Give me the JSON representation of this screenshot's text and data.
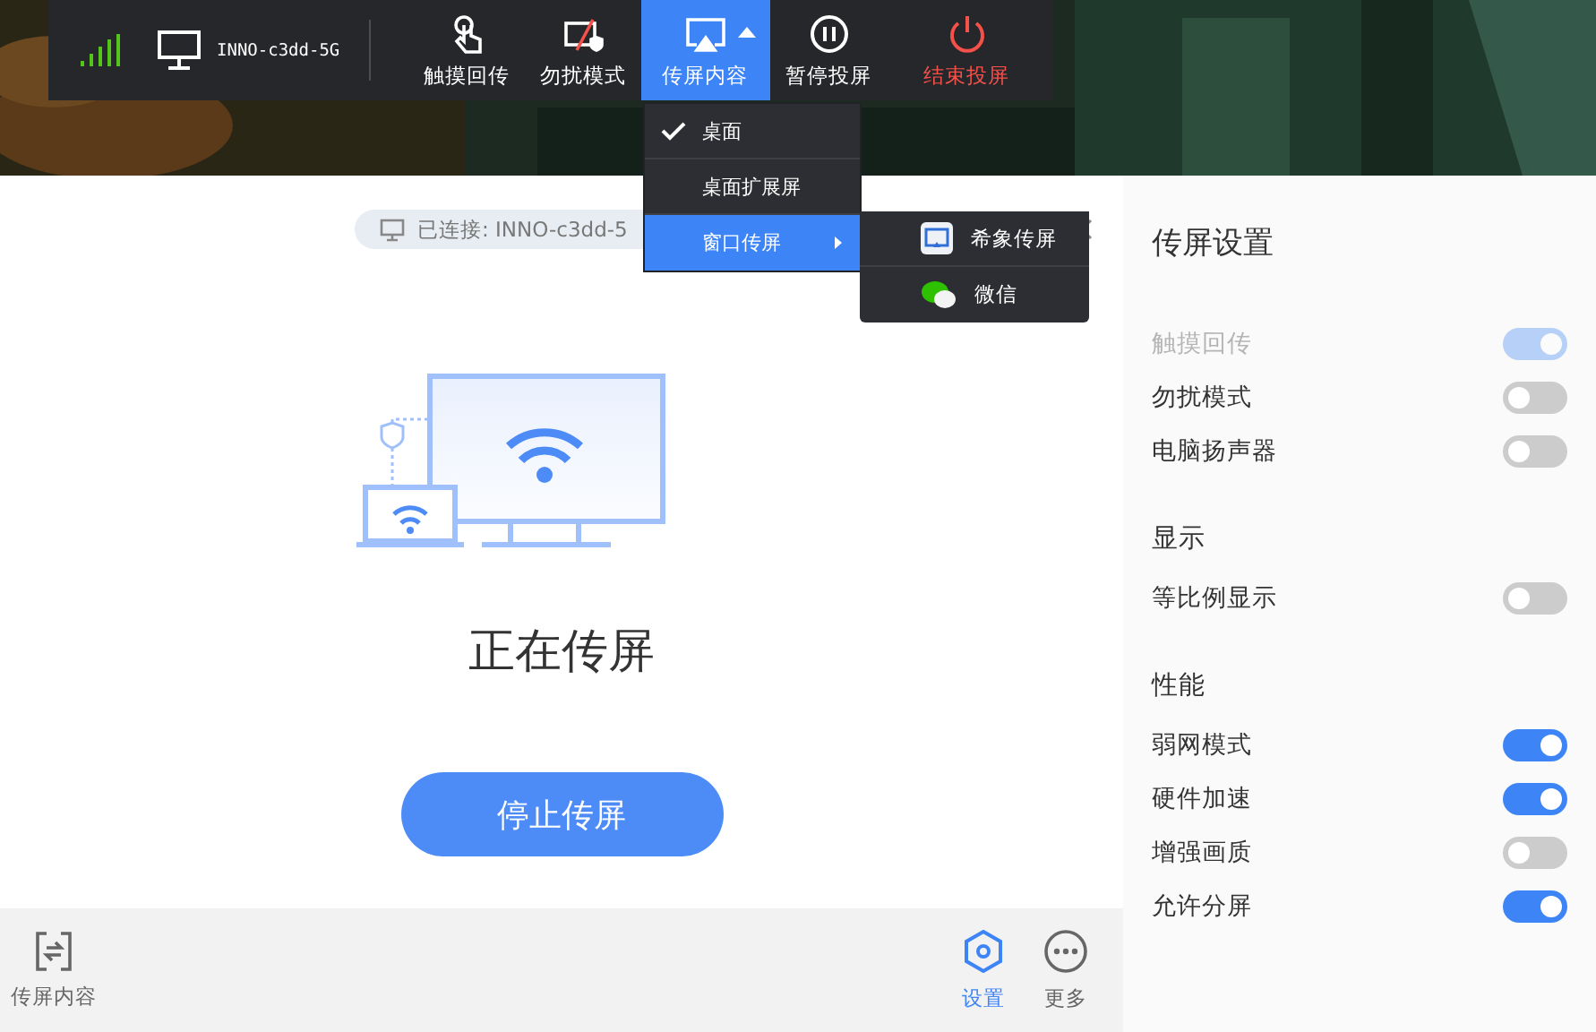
{
  "toolbar": {
    "device": "INNO-c3dd-5G",
    "buttons": [
      {
        "label": "触摸回传",
        "selected": false,
        "kind": "normal"
      },
      {
        "label": "勿扰模式",
        "selected": false,
        "kind": "normal"
      },
      {
        "label": "传屏内容",
        "selected": true,
        "kind": "normal"
      },
      {
        "label": "暂停投屏",
        "selected": false,
        "kind": "normal"
      },
      {
        "label": "结束投屏",
        "selected": false,
        "kind": "danger"
      }
    ]
  },
  "menu": {
    "items": [
      {
        "label": "桌面",
        "checked": true,
        "selected": false,
        "submenu": false
      },
      {
        "label": "桌面扩展屏",
        "checked": false,
        "selected": false,
        "submenu": false
      },
      {
        "label": "窗口传屏",
        "checked": false,
        "selected": true,
        "submenu": true
      }
    ],
    "submenu": [
      {
        "label": "希象传屏"
      },
      {
        "label": "微信"
      }
    ]
  },
  "status": {
    "text": "已连接: INNO-c3dd-5"
  },
  "main": {
    "title": "正在传屏",
    "button": "停止传屏"
  },
  "bottom_bar": {
    "left": [
      {
        "label": "传屏内容",
        "selected": false
      }
    ],
    "right": [
      {
        "label": "设置",
        "selected": true
      },
      {
        "label": "更多",
        "selected": false
      }
    ]
  },
  "settings": {
    "title": "传屏设置",
    "groups": [
      {
        "items": [
          {
            "label": "触摸回传",
            "on": true,
            "faded": true
          },
          {
            "label": "勿扰模式",
            "on": false,
            "faded": false
          },
          {
            "label": "电脑扬声器",
            "on": false,
            "faded": false
          }
        ]
      },
      {
        "heading": "显示",
        "items": [
          {
            "label": "等比例显示",
            "on": false,
            "faded": false
          }
        ]
      },
      {
        "heading": "性能",
        "items": [
          {
            "label": "弱网模式",
            "on": true,
            "faded": false
          },
          {
            "label": "硬件加速",
            "on": true,
            "faded": false
          },
          {
            "label": "增强画质",
            "on": false,
            "faded": false
          },
          {
            "label": "允许分屏",
            "on": true,
            "faded": false
          }
        ]
      }
    ]
  }
}
